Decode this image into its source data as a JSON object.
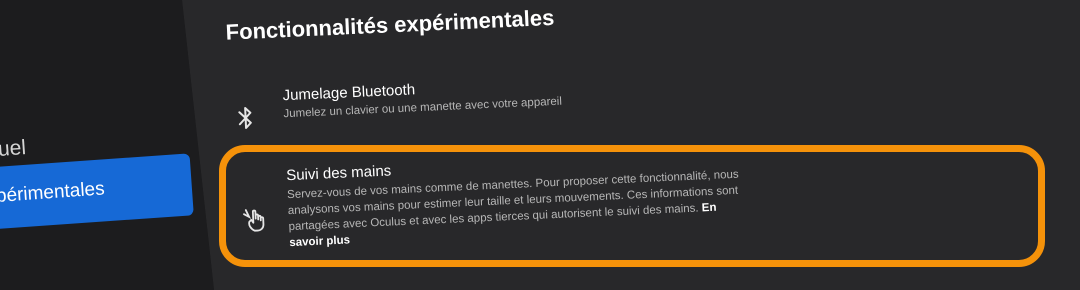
{
  "sidebar": {
    "items": [
      {
        "label": "uel"
      },
      {
        "label": "périmentales",
        "active": true
      }
    ],
    "accent_color": "#1669d6"
  },
  "main": {
    "title": "Fonctionnalités expérimentales",
    "settings": [
      {
        "icon": "bluetooth-icon",
        "title": "Jumelage Bluetooth",
        "description": "Jumelez un clavier ou une manette avec votre appareil"
      },
      {
        "icon": "hand-tracking-icon",
        "title": "Suivi des mains",
        "description": "Servez-vous de vos mains comme de manettes. Pour proposer cette fonctionnalité, nous analysons vos mains pour estimer leur taille et leurs mouvements. Ces informations sont partagées avec Oculus et avec les apps tierces qui autorisent le suivi des mains.",
        "link": "En savoir plus"
      }
    ]
  },
  "highlight_color": "#f5920a"
}
